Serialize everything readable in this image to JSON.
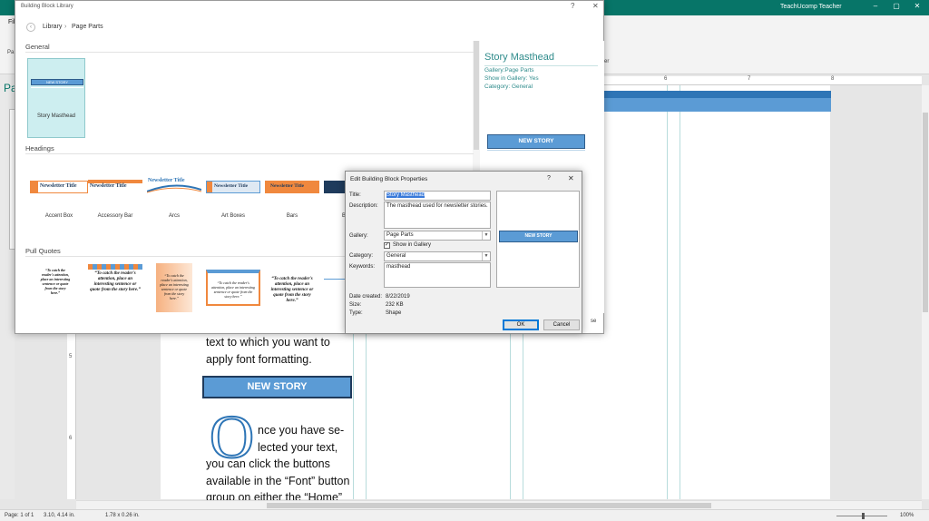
{
  "app": {
    "user_name": "TeachUcomp Teacher",
    "file_tab": "Fil",
    "pages_pane_label": "Pa",
    "ribbon_fragment_left": "Pa",
    "ribbon_fragment_right": "er"
  },
  "window_controls": {
    "minimize": "–",
    "restore": "▢",
    "close": "✕",
    "help": "?"
  },
  "document": {
    "ruler_numbers": [
      "6",
      "7",
      "8"
    ],
    "vertical_ruler_numbers": [
      "5",
      "6"
    ],
    "text_top": [
      "text to which you want to",
      "apply font formatting."
    ],
    "banner": "NEW STORY",
    "dropcap": "O",
    "text_bottom": [
      "nce you have se-",
      "lected your text,",
      "you can click the buttons",
      "available in the “Font” button",
      "group on either the “Home”"
    ]
  },
  "status_bar": {
    "page": "Page: 1 of 1",
    "position": "3.10, 4.14 in.",
    "size": "1.78 x 0.26 in.",
    "zoom": "100%"
  },
  "library_dialog": {
    "title": "Building Block Library",
    "breadcrumb": [
      "Library",
      "Page Parts"
    ],
    "sections": {
      "general": "General",
      "headings": "Headings",
      "pull_quotes": "Pull Quotes"
    },
    "general_items": [
      {
        "label": "Story Masthead",
        "thumb_text": "NEW STORY"
      }
    ],
    "headings_items": [
      {
        "label": "Accent Box",
        "thumb_text": "Newsletter Title"
      },
      {
        "label": "Accessory Bar",
        "thumb_text": "Newsletter Title"
      },
      {
        "label": "Arcs",
        "thumb_text": "Newsletter Title"
      },
      {
        "label": "Art Boxes",
        "thumb_text": "Newsletter Title"
      },
      {
        "label": "Bars",
        "thumb_text": "Newsletter Title"
      },
      {
        "label": "B",
        "thumb_text": ""
      }
    ],
    "quote_text": "“To catch the reader's attention, place an interesting sentence or quote from the story here.”",
    "preview": {
      "title": "Story Masthead",
      "gallery": "Gallery:Page Parts",
      "show_in_gallery": "Show in Gallery: Yes",
      "category": "Category: General",
      "banner": "NEW STORY"
    },
    "close_button": "se"
  },
  "properties_dialog": {
    "title": "Edit Building Block Properties",
    "labels": {
      "title": "Title:",
      "description": "Description:",
      "gallery": "Gallery:",
      "category": "Category:",
      "keywords": "Keywords:"
    },
    "values": {
      "title": "Story Masthead",
      "description": "The masthead used for newsletter stories.",
      "gallery": "Page Parts",
      "category": "General",
      "keywords": "masthead"
    },
    "show_in_gallery_label": "Show in Gallery",
    "show_in_gallery_checked": true,
    "info": [
      {
        "label": "Date created:",
        "value": "8/22/2019"
      },
      {
        "label": "Size:",
        "value": "232 KB"
      },
      {
        "label": "Type:",
        "value": "Shape"
      }
    ],
    "preview_banner": "NEW STORY",
    "ok": "OK",
    "cancel": "Cancel"
  },
  "colors": {
    "titlebar": "#077568",
    "accent_teal": "#2e8b8b",
    "masthead_blue": "#5b9bd5",
    "selection_blue": "#3879d9"
  }
}
